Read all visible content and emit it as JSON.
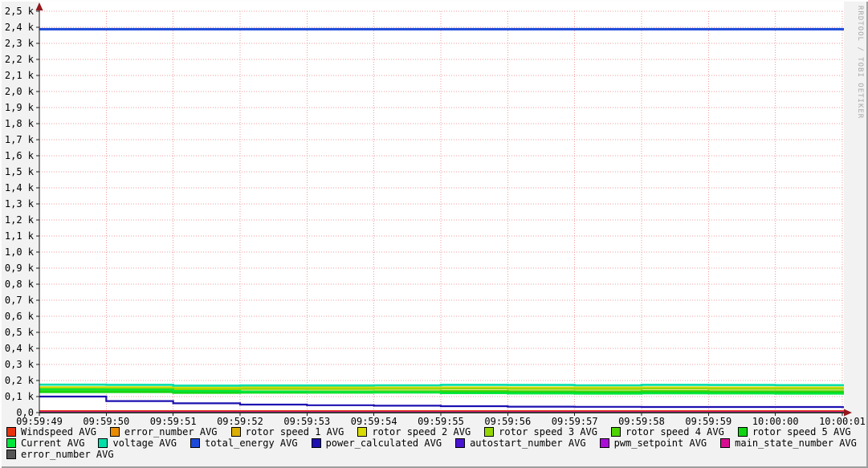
{
  "watermark": "RRDTOOL / TOBI OETIKER",
  "axes": {
    "y_labels": [
      "2,5 k",
      "2,4 k",
      "2,3 k",
      "2,2 k",
      "2,1 k",
      "2,0 k",
      "1,9 k",
      "1,8 k",
      "1,7 k",
      "1,6 k",
      "1,5 k",
      "1,4 k",
      "1,3 k",
      "1,2 k",
      "1,1 k",
      "1,0 k",
      "0,9 k",
      "0,8 k",
      "0,7 k",
      "0,6 k",
      "0,5 k",
      "0,4 k",
      "0,3 k",
      "0,2 k",
      "0,1 k",
      "0,0"
    ],
    "x_labels": [
      "09:59:49",
      "09:59:50",
      "09:59:51",
      "09:59:52",
      "09:59:53",
      "09:59:54",
      "09:59:55",
      "09:59:56",
      "09:59:57",
      "09:59:58",
      "09:59:59",
      "10:00:00",
      "10:00:01"
    ]
  },
  "colors": {
    "grid": "#ef9e9e",
    "axis": "#1a1a1a",
    "arrow": "#94171c",
    "canvas": "#ffffff",
    "background": "#f2f2f2"
  },
  "legend": {
    "rows": [
      [
        {
          "label": "Windspeed AVG",
          "color": "#e7320e"
        },
        {
          "label": "error_number AVG",
          "color": "#e98b00"
        },
        {
          "label": "rotor speed 1 AVG",
          "color": "#dcae00"
        },
        {
          "label": "rotor speed 2 AVG",
          "color": "#d8dc00"
        },
        {
          "label": "rotor speed 3 AVG",
          "color": "#96d600"
        },
        {
          "label": "rotor speed 4 AVG",
          "color": "#4cd300"
        },
        {
          "label": "rotor speed 5 AVG",
          "color": "#11d511"
        }
      ],
      [
        {
          "label": "Current AVG",
          "color": "#00e63c"
        },
        {
          "label": "voltage AVG",
          "color": "#00dfa8"
        },
        {
          "label": "total_energy AVG",
          "color": "#1b49d9"
        },
        {
          "label": "power_calculated AVG",
          "color": "#1c10b0"
        },
        {
          "label": "autostart_number AVG",
          "color": "#4813d2"
        },
        {
          "label": "pwm_setpoint AVG",
          "color": "#a90dd6"
        },
        {
          "label": "main_state_number AVG",
          "color": "#d80c90"
        }
      ],
      [
        {
          "label": "error_number AVG",
          "color": "#555555"
        }
      ]
    ]
  },
  "chart_data": {
    "type": "line",
    "title": "",
    "xlabel": "",
    "ylabel": "",
    "ylim": [
      0,
      2.5
    ],
    "unit": "k",
    "grid": true,
    "legend_position": "bottom",
    "x": [
      "09:59:49",
      "09:59:50",
      "09:59:51",
      "09:59:52",
      "09:59:53",
      "09:59:54",
      "09:59:55",
      "09:59:56",
      "09:59:57",
      "09:59:58",
      "09:59:59",
      "10:00:00",
      "10:00:01"
    ],
    "series": [
      {
        "name": "Windspeed AVG",
        "color": "#e7320e",
        "width": 2,
        "values": [
          0.01,
          0.01,
          0.01,
          0.01,
          0.01,
          0.01,
          0.01,
          0.01,
          0.01,
          0.01,
          0.01,
          0.01,
          0.01
        ]
      },
      {
        "name": "error_number AVG",
        "color": "#e98b00",
        "width": 2,
        "values": [
          0,
          0,
          0,
          0,
          0,
          0,
          0,
          0,
          0,
          0,
          0,
          0,
          0
        ]
      },
      {
        "name": "rotor speed 1 AVG",
        "color": "#dcae00",
        "width": 2.4,
        "values": [
          0.157,
          0.157,
          0.154,
          0.155,
          0.155,
          0.155,
          0.156,
          0.155,
          0.155,
          0.156,
          0.155,
          0.155,
          0.155
        ]
      },
      {
        "name": "rotor speed 2 AVG",
        "color": "#d8dc00",
        "width": 2.4,
        "values": [
          0.158,
          0.158,
          0.155,
          0.156,
          0.156,
          0.156,
          0.157,
          0.156,
          0.156,
          0.157,
          0.156,
          0.156,
          0.156
        ]
      },
      {
        "name": "rotor speed 3 AVG",
        "color": "#96d600",
        "width": 2.4,
        "values": [
          0.15,
          0.15,
          0.146,
          0.147,
          0.147,
          0.148,
          0.149,
          0.148,
          0.147,
          0.149,
          0.148,
          0.148,
          0.148
        ]
      },
      {
        "name": "rotor speed 4 AVG",
        "color": "#4cd300",
        "width": 2.4,
        "values": [
          0.135,
          0.135,
          0.131,
          0.132,
          0.132,
          0.133,
          0.134,
          0.133,
          0.132,
          0.134,
          0.133,
          0.133,
          0.133
        ]
      },
      {
        "name": "rotor speed 5 AVG",
        "color": "#11d511",
        "width": 2.4,
        "values": [
          0.128,
          0.128,
          0.123,
          0.124,
          0.124,
          0.125,
          0.126,
          0.125,
          0.124,
          0.126,
          0.125,
          0.125,
          0.125
        ]
      },
      {
        "name": "Current AVG",
        "color": "#00e63c",
        "width": 2.4,
        "values": [
          0.144,
          0.143,
          0.134,
          0.13,
          0.128,
          0.126,
          0.121,
          0.119,
          0.118,
          0.12,
          0.119,
          0.118,
          0.118
        ]
      },
      {
        "name": "voltage AVG",
        "color": "#00dfa8",
        "width": 2.6,
        "values": [
          0.174,
          0.173,
          0.168,
          0.169,
          0.169,
          0.17,
          0.173,
          0.172,
          0.17,
          0.173,
          0.172,
          0.171,
          0.171
        ]
      },
      {
        "name": "total_energy AVG",
        "color": "#1b49d9",
        "width": 3,
        "values": [
          2.388,
          2.388,
          2.388,
          2.388,
          2.388,
          2.388,
          2.388,
          2.388,
          2.388,
          2.388,
          2.388,
          2.388,
          2.388
        ]
      },
      {
        "name": "power_calculated AVG",
        "color": "#1c10b0",
        "width": 2.2,
        "values": [
          0.1,
          0.072,
          0.058,
          0.05,
          0.046,
          0.043,
          0.04,
          0.037,
          0.036,
          0.035,
          0.035,
          0.035,
          0.034
        ]
      },
      {
        "name": "autostart_number AVG",
        "color": "#4813d2",
        "width": 2,
        "values": [
          0,
          0,
          0,
          0,
          0,
          0,
          0,
          0,
          0,
          0,
          0,
          0,
          0
        ]
      },
      {
        "name": "pwm_setpoint AVG",
        "color": "#a90dd6",
        "width": 2,
        "values": [
          0,
          0,
          0,
          0,
          0,
          0,
          0,
          0,
          0,
          0,
          0,
          0,
          0
        ]
      },
      {
        "name": "main_state_number AVG",
        "color": "#d80c90",
        "width": 2,
        "values": [
          0.004,
          0.004,
          0.004,
          0.004,
          0.004,
          0.004,
          0.004,
          0.004,
          0.004,
          0.004,
          0.004,
          0.004,
          0.004
        ]
      },
      {
        "name": "error_number AVG",
        "color": "#555555",
        "width": 2,
        "values": [
          0,
          0,
          0,
          0,
          0,
          0,
          0,
          0,
          0,
          0,
          0,
          0,
          0
        ]
      }
    ]
  }
}
